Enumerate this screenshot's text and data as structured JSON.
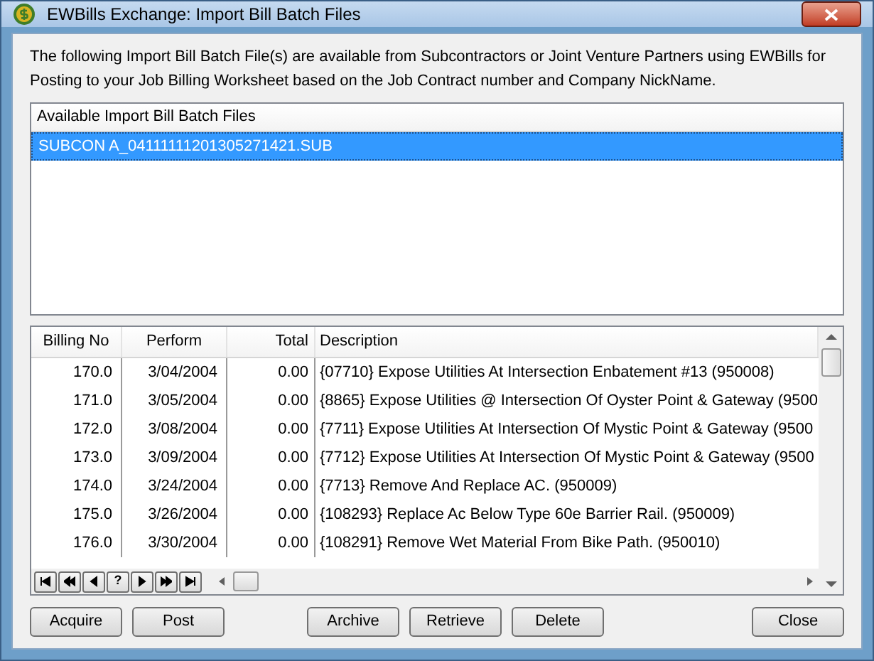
{
  "window": {
    "title": "EWBills Exchange: Import Bill Batch Files"
  },
  "intro": "The following Import Bill Batch File(s) are available from Subcontractors or Joint Venture Partners using EWBills for Posting to your Job Billing Worksheet based on the Job Contract number and Company NickName.",
  "files": {
    "header": "Available Import Bill Batch Files",
    "items": [
      {
        "label": "SUBCON A_04111111201305271421.SUB",
        "selected": true
      }
    ]
  },
  "table": {
    "columns": [
      "Billing No",
      "Perform",
      "Total",
      "Description"
    ],
    "rows": [
      [
        "170.0",
        "3/04/2004",
        "0.00",
        "{07710} Expose Utilities At Intersection Enbatement #13 (950008)"
      ],
      [
        "171.0",
        "3/05/2004",
        "0.00",
        "{8865} Expose Utilities @ Intersection Of Oyster Point & Gateway (9500"
      ],
      [
        "172.0",
        "3/08/2004",
        "0.00",
        "{7711} Expose Utilities At Intersection Of Mystic Point & Gateway (9500"
      ],
      [
        "173.0",
        "3/09/2004",
        "0.00",
        "{7712} Expose Utilities At Intersection Of Mystic Point & Gateway (9500"
      ],
      [
        "174.0",
        "3/24/2004",
        "0.00",
        "{7713} Remove And Replace AC. (950009)"
      ],
      [
        "175.0",
        "3/26/2004",
        "0.00",
        "{108293} Replace Ac Below Type 60e Barrier Rail. (950009)"
      ],
      [
        "176.0",
        "3/30/2004",
        "0.00",
        "{108291} Remove Wet Material From Bike Path. (950010)"
      ]
    ]
  },
  "navigator": [
    {
      "kind": "first"
    },
    {
      "kind": "prior-page"
    },
    {
      "kind": "prior"
    },
    {
      "kind": "find",
      "label": "?"
    },
    {
      "kind": "next"
    },
    {
      "kind": "next-page"
    },
    {
      "kind": "last"
    }
  ],
  "buttons_left": [
    "Acquire",
    "Post"
  ],
  "buttons_middle": [
    "Archive",
    "Retrieve",
    "Delete"
  ],
  "buttons_right": [
    "Close"
  ]
}
